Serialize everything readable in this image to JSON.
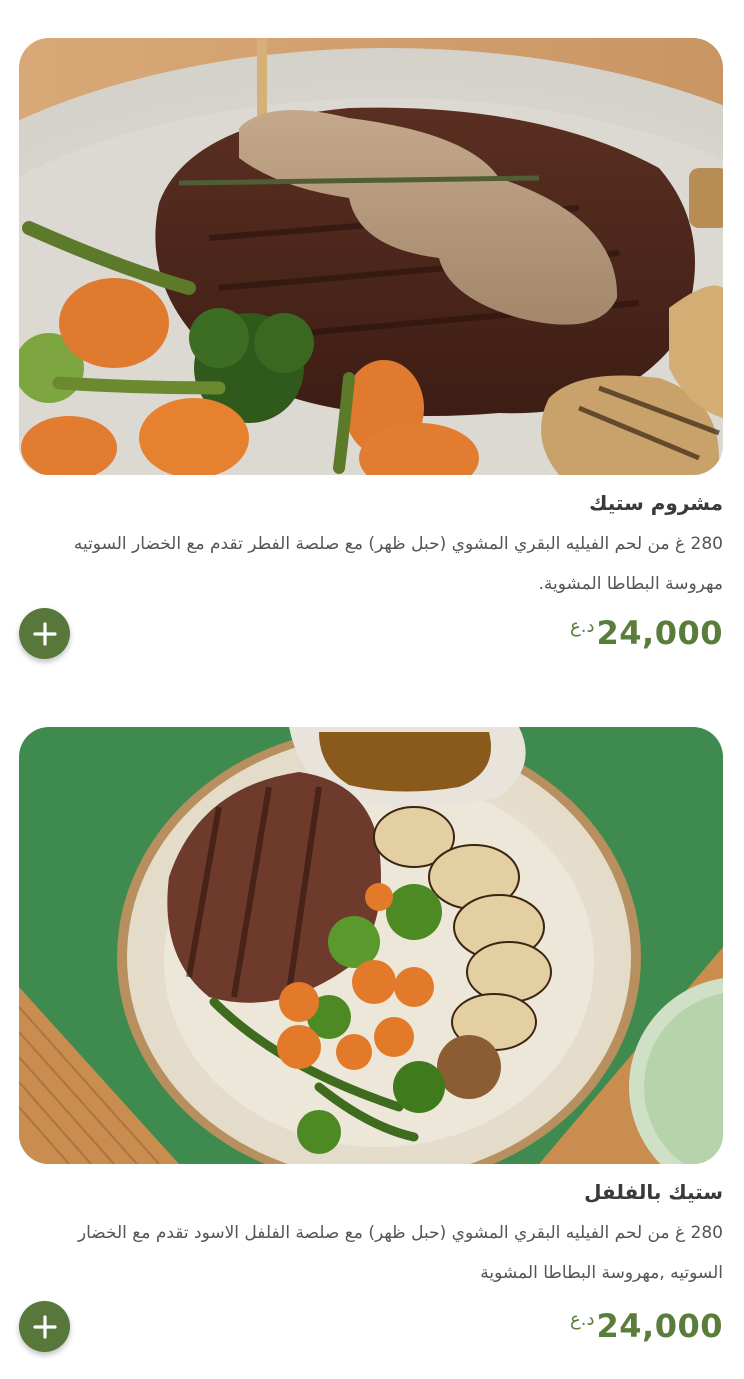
{
  "items": [
    {
      "name": "مشروم ستيك",
      "description": "280 غ من لحم الفيليه البقري المشوي (حبل ظهر) مع صلصة الفطر تقدم مع الخضار السوتيه مهروسة البطاطا المشوية.",
      "price": "24,000",
      "currency": "د.ع",
      "image_icon": "steak-with-mushroom-sauce-photo",
      "add_icon": "plus-icon"
    },
    {
      "name": "ستيك بالفلفل",
      "description": "280 غ من لحم الفيليه البقري المشوي (حبل ظهر) مع صلصة الفلفل الاسود تقدم مع الخضار السوتيه ,مهروسة البطاطا المشوية",
      "price": "24,000",
      "currency": "د.ع",
      "image_icon": "pepper-steak-plate-photo",
      "add_icon": "plus-icon"
    }
  ],
  "colors": {
    "accent": "#58773a",
    "price": "#5a7d3c",
    "title": "#3a3a3a",
    "text": "#555555"
  }
}
